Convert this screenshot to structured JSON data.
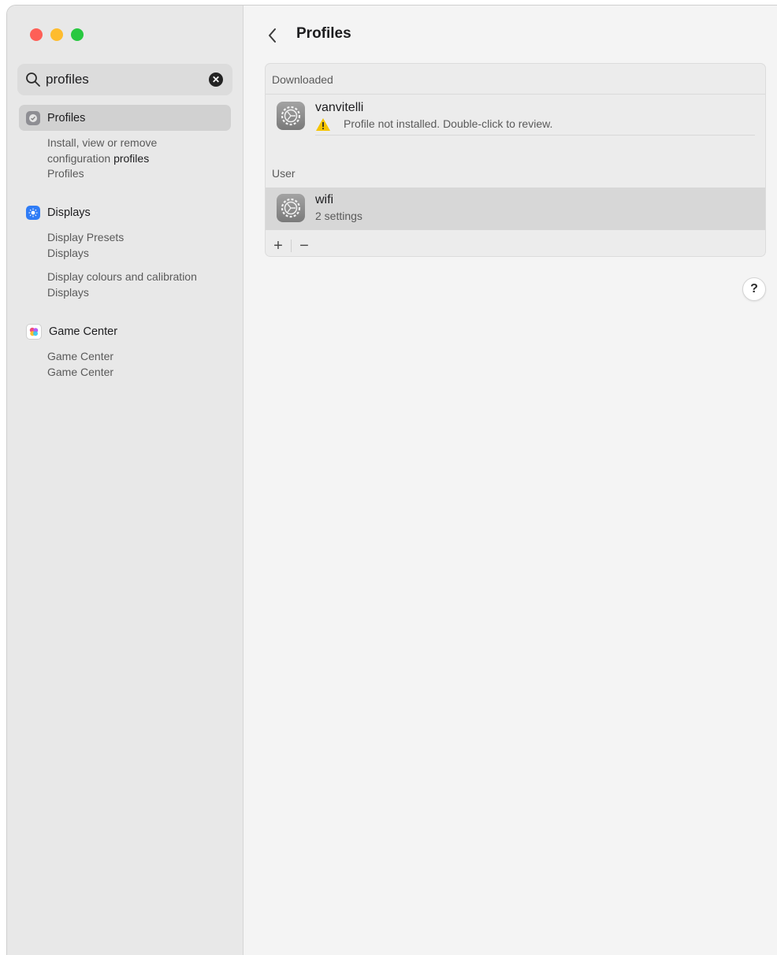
{
  "sidebar": {
    "search": {
      "value": "profiles",
      "placeholder": "Search"
    },
    "results": [
      {
        "label": "Profiles",
        "icon": "profiles-icon",
        "subs": [
          {
            "line1_pre": "Install, view or remove",
            "line2_pre": "configuration ",
            "line2_bold": "profiles",
            "line3": "Profiles"
          }
        ]
      },
      {
        "label": "Displays",
        "icon": "displays-icon",
        "subs": [
          {
            "line1": "Display Presets",
            "line2": "Displays"
          },
          {
            "line1": "Display colours and calibration",
            "line2": "Displays"
          }
        ]
      },
      {
        "label": "Game Center",
        "icon": "game-center-icon",
        "subs": [
          {
            "line1": "Game Center",
            "line2": "Game Center"
          }
        ]
      }
    ]
  },
  "main": {
    "title": "Profiles",
    "sections": [
      {
        "header": "Downloaded",
        "items": [
          {
            "name": "vanvitelli",
            "detail": "Profile not installed. Double-click to review.",
            "warning": true
          }
        ]
      },
      {
        "header": "User",
        "items": [
          {
            "name": "wifi",
            "detail": "2 settings",
            "selected": true
          }
        ]
      }
    ],
    "controls": {
      "add": "+",
      "remove": "−"
    },
    "help": "?"
  },
  "colors": {
    "close": "#fe5f57",
    "minimize": "#febc2e",
    "zoom": "#28c840",
    "displays_accent": "#2f7cf6",
    "warning": "#f5c400"
  }
}
